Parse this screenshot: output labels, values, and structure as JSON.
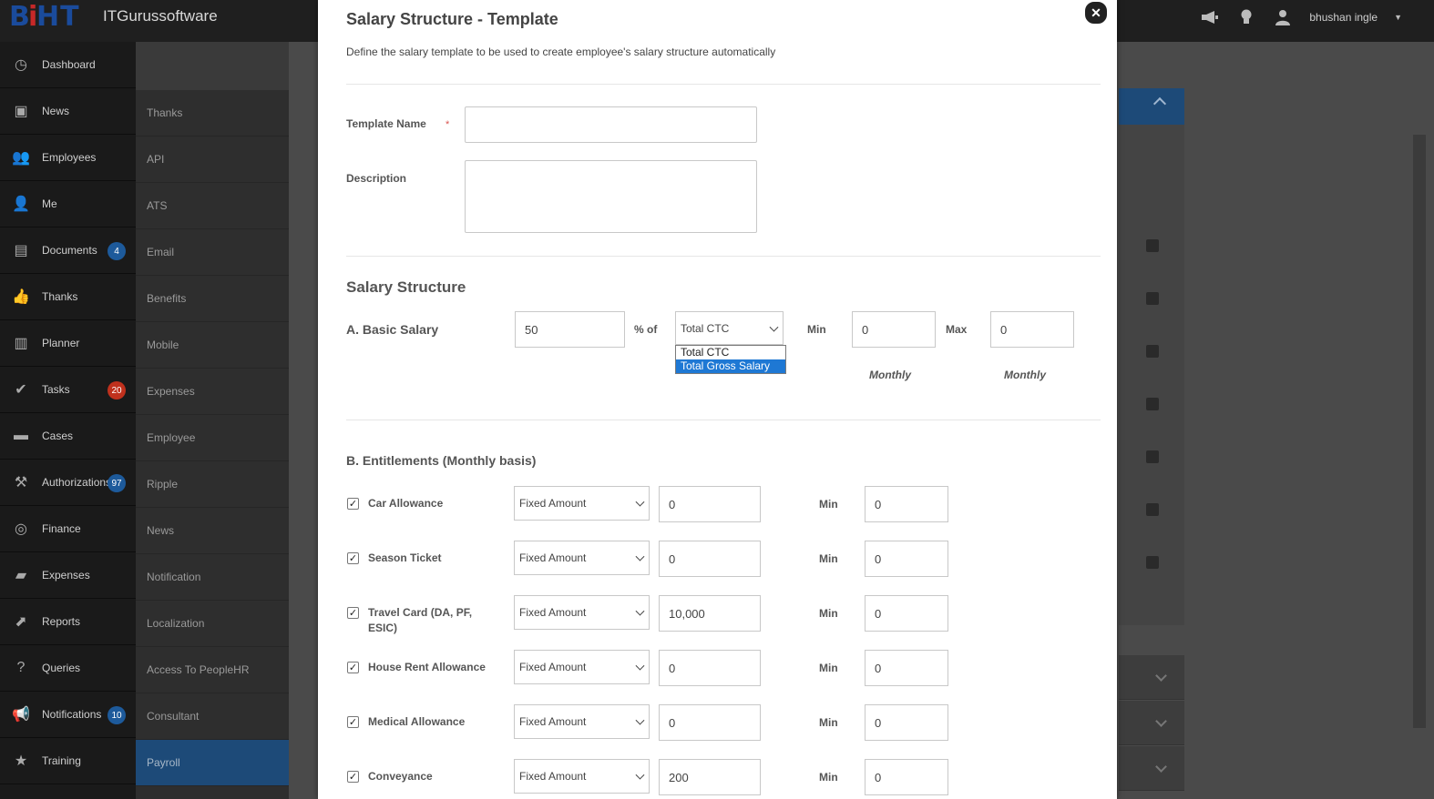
{
  "app": {
    "brand": "ITGurussoftware",
    "logo_text": "BiHT",
    "user": "bhushan ingle"
  },
  "sidebar": {
    "items": [
      {
        "label": "Dashboard",
        "icon": "dashboard-icon"
      },
      {
        "label": "News",
        "icon": "tv-icon"
      },
      {
        "label": "Employees",
        "icon": "users-icon"
      },
      {
        "label": "Me",
        "icon": "user-icon"
      },
      {
        "label": "Documents",
        "icon": "documents-icon",
        "badge": "4"
      },
      {
        "label": "Thanks",
        "icon": "thumbs-up-icon"
      },
      {
        "label": "Planner",
        "icon": "planner-icon"
      },
      {
        "label": "Tasks",
        "icon": "check-icon",
        "badge": "20"
      },
      {
        "label": "Cases",
        "icon": "folder-icon"
      },
      {
        "label": "Authorizations",
        "icon": "gavel-icon",
        "badge": "97"
      },
      {
        "label": "Finance",
        "icon": "finance-icon"
      },
      {
        "label": "Expenses",
        "icon": "wallet-icon"
      },
      {
        "label": "Reports",
        "icon": "chart-icon"
      },
      {
        "label": "Queries",
        "icon": "question-icon"
      },
      {
        "label": "Notifications",
        "icon": "megaphone-icon",
        "badge": "10"
      },
      {
        "label": "Training",
        "icon": "star-icon"
      }
    ]
  },
  "submenu": {
    "items": [
      "Thanks",
      "API",
      "ATS",
      "Email",
      "Benefits",
      "Mobile",
      "Expenses",
      "Employee",
      "Ripple",
      "News",
      "Notification",
      "Localization",
      "Access To PeopleHR",
      "Consultant",
      "Payroll"
    ]
  },
  "modal": {
    "title": "Salary Structure - Template",
    "subtitle": "Define the salary template to be used to create employee's salary structure automatically",
    "template_name_label": "Template Name",
    "required_mark": "*",
    "template_name_value": "",
    "description_label": "Description",
    "description_value": "",
    "salary_structure_title": "Salary Structure",
    "basic": {
      "label": "A. Basic Salary",
      "percent": "50",
      "percent_of_label": "% of",
      "selected": "Total CTC",
      "options": [
        "Total CTC",
        "Total Gross Salary"
      ],
      "highlighted_option": "Total Gross Salary",
      "min_label": "Min",
      "min_value": "0",
      "max_label": "Max",
      "max_value": "0",
      "monthly_label_1": "Monthly",
      "monthly_label_2": "Monthly"
    },
    "entitlements_title": "B. Entitlements (Monthly basis)",
    "entitlements": [
      {
        "label": "Car Allowance",
        "type": "Fixed Amount",
        "amount": "0",
        "min_label": "Min",
        "min": "0",
        "checked": true
      },
      {
        "label": "Season Ticket",
        "type": "Fixed Amount",
        "amount": "0",
        "min_label": "Min",
        "min": "0",
        "checked": true
      },
      {
        "label": "Travel Card (DA, PF, ESIC)",
        "type": "Fixed Amount",
        "amount": "10,000",
        "min_label": "Min",
        "min": "0",
        "checked": true
      },
      {
        "label": "House Rent Allowance",
        "type": "Fixed Amount",
        "amount": "0",
        "min_label": "Min",
        "min": "0",
        "checked": true
      },
      {
        "label": "Medical Allowance",
        "type": "Fixed Amount",
        "amount": "0",
        "min_label": "Min",
        "min": "0",
        "checked": true
      },
      {
        "label": "Conveyance",
        "type": "Fixed Amount",
        "amount": "200",
        "min_label": "Min",
        "min": "0",
        "checked": true
      }
    ]
  }
}
